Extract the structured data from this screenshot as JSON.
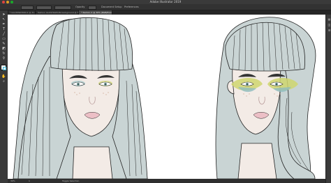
{
  "window": {
    "title": "Adobe Illustrator 2019"
  },
  "options_bar": {
    "items": [
      "Opacity",
      "Document Setup",
      "Preferences"
    ]
  },
  "tabs": [
    {
      "label": "* ILLUSTRATION 2 @ 31.21% (CMYK/Preview)",
      "active": false
    },
    {
      "label": "fashion ILLUSTRATION background @ 50% (CMYK/Preview)",
      "active": false
    },
    {
      "label": "* fashion 2 @ 30% (RGB/Preview)",
      "active": true
    }
  ],
  "tools": [
    "select-arrow-icon",
    "direct-select-icon",
    "pen-icon",
    "type-icon",
    "line-icon",
    "rectangle-icon",
    "brush-icon",
    "pencil-icon",
    "eraser-icon",
    "rotate-icon",
    "scale-icon",
    "warp-icon",
    "eyedropper-icon",
    "blend-icon",
    "hand-icon",
    "zoom-icon"
  ],
  "status": {
    "zoom": "30%",
    "page": "1",
    "tool": "Toggle Selection"
  },
  "colors": {
    "hair": "#c9d4d4",
    "skin": "#f3ebe6",
    "lips": "#ecbfc6",
    "eye_green": "#cfd66f",
    "eye_teal": "#8fbcbf",
    "accent": "#2ea8c8"
  }
}
